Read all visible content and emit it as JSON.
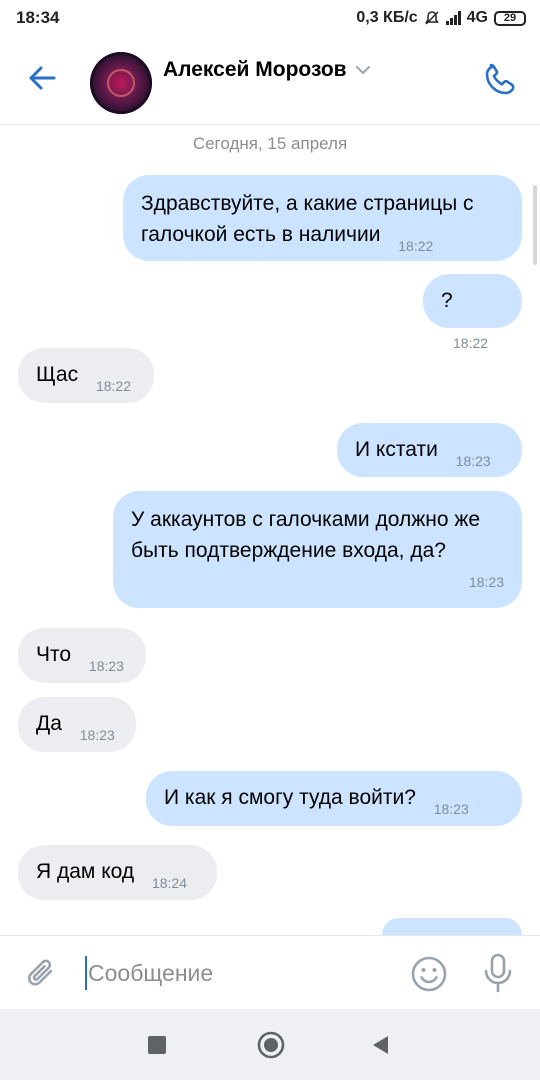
{
  "status_bar": {
    "time": "18:34",
    "speed": "0,3 КБ/с",
    "network": "4G",
    "battery": "29"
  },
  "header": {
    "contact_name": "Алексей Морозов"
  },
  "chat": {
    "date_separator": "Сегодня, 15 апреля",
    "messages": [
      {
        "direction": "out",
        "text": "Здравствуйте, а какие страницы с галочкой есть в наличии",
        "time": "18:22"
      },
      {
        "direction": "out",
        "text": "?",
        "time": "18:22"
      },
      {
        "direction": "in",
        "text": "Щас",
        "time": "18:22"
      },
      {
        "direction": "out",
        "text": "И кстати",
        "time": "18:23"
      },
      {
        "direction": "out",
        "text": "У аккаунтов с галочками должно же быть подтверждение входа, да?",
        "time": "18:23"
      },
      {
        "direction": "in",
        "text": "Что",
        "time": "18:23"
      },
      {
        "direction": "in",
        "text": "Да",
        "time": "18:23"
      },
      {
        "direction": "out",
        "text": "И как я смогу туда войти?",
        "time": "18:23"
      },
      {
        "direction": "in",
        "text": "Я дам код",
        "time": "18:24"
      },
      {
        "direction": "out",
        "text": "",
        "time": ""
      }
    ]
  },
  "composer": {
    "placeholder": "Сообщение",
    "value": ""
  },
  "colors": {
    "accent": "#2a6fc4",
    "outgoing_bubble": "#cce4ff",
    "incoming_bubble": "#ebedf0",
    "timestamp": "#818c99"
  },
  "icons": {
    "back": "arrow-left-icon",
    "call": "phone-icon",
    "attach": "paperclip-icon",
    "emoji": "smiley-icon",
    "mic": "microphone-icon"
  }
}
